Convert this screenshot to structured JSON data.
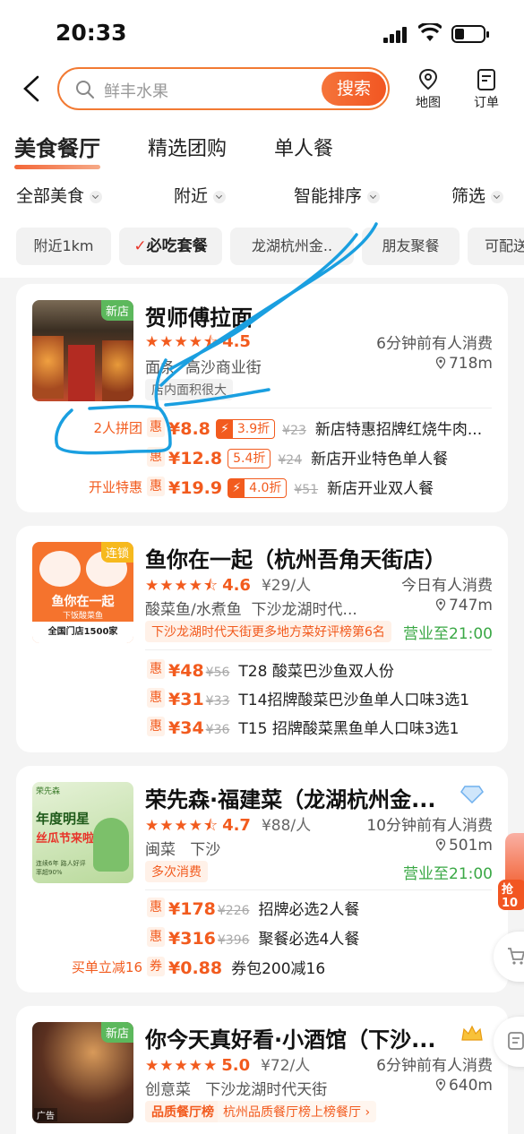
{
  "status": {
    "time": "20:33"
  },
  "header": {
    "search_placeholder": "鲜丰水果",
    "search_button": "搜索",
    "map_label": "地图",
    "orders_label": "订单"
  },
  "tabs": [
    "美食餐厅",
    "精选团购",
    "单人餐"
  ],
  "filters": [
    "全部美食",
    "附近",
    "智能排序",
    "筛选"
  ],
  "chips": [
    "附近1km",
    "必吃套餐",
    "龙湖杭州金..",
    "朋友聚餐",
    "可配送"
  ],
  "restaurants": [
    {
      "name": "贺师傅拉面",
      "badge": "新店",
      "stars": "★★★★⯪",
      "score": "4.5",
      "avg": "",
      "recent": "6分钟前有人消费",
      "category": "面条",
      "area": "高沙商业街",
      "distance": "718m",
      "tag": "店内面积很大",
      "deals": [
        {
          "label": "2人拼团",
          "price": "¥8.8",
          "discount": "3.9折",
          "orig": "¥23",
          "name": "新店特惠招牌红烧牛肉..."
        },
        {
          "label": "",
          "price": "¥12.8",
          "discount": "5.4折",
          "orig": "¥24",
          "name": "新店开业特色单人餐"
        },
        {
          "label": "开业特惠",
          "price": "¥19.9",
          "discount": "4.0折",
          "orig": "¥51",
          "name": "新店开业双人餐"
        }
      ]
    },
    {
      "name": "鱼你在一起（杭州吾角天街店）",
      "badge": "连锁",
      "logo_main": "鱼你在一起",
      "logo_sub": "下饭酸菜鱼",
      "logo_foot": "全国门店1500家",
      "stars": "★★★★⯪",
      "score": "4.6",
      "avg": "¥29/人",
      "recent": "今日有人消费",
      "category": "酸菜鱼/水煮鱼",
      "area": "下沙龙湖时代...",
      "distance": "747m",
      "tag": "下沙龙湖时代天街更多地方菜好评榜第6名",
      "open": "营业至21:00",
      "deals": [
        {
          "price": "¥48",
          "orig": "¥56",
          "name": "T28 酸菜巴沙鱼双人份"
        },
        {
          "price": "¥31",
          "orig": "¥33",
          "name": "T14招牌酸菜巴沙鱼单人口味3选1"
        },
        {
          "price": "¥34",
          "orig": "¥36",
          "name": "T15 招牌酸菜黑鱼单人口味3选1"
        }
      ]
    },
    {
      "name": "荣先森·福建菜（龙湖杭州金...",
      "logo_top": "荣先森",
      "logo_main": "年度明星",
      "logo_sub": "丝瓜节来啦",
      "logo_foot": "连续6年 路人好评率超90%",
      "stars": "★★★★⯪",
      "score": "4.7",
      "avg": "¥88/人",
      "recent": "10分钟前有人消费",
      "category": "闽菜",
      "area": "下沙",
      "distance": "501m",
      "tag": "多次消费",
      "open": "营业至21:00",
      "deals": [
        {
          "label": "",
          "type": "惠",
          "price": "¥178",
          "orig": "¥226",
          "name": "招牌必选2人餐"
        },
        {
          "label": "",
          "type": "惠",
          "price": "¥316",
          "orig": "¥396",
          "name": "聚餐必选4人餐"
        },
        {
          "label": "买单立减16",
          "type": "券",
          "price": "¥0.88",
          "orig": "",
          "name": "券包200减16"
        }
      ]
    },
    {
      "name": "你今天真好看·小酒馆（下沙...",
      "badge": "新店",
      "ad": "广告",
      "stars": "★★★★★",
      "score": "5.0",
      "avg": "¥72/人",
      "recent": "6分钟前有人消费",
      "category": "创意菜",
      "area": "下沙龙湖时代天街",
      "distance": "640m",
      "rank_label": "品质餐厅榜",
      "rank_text": "杭州品质餐厅榜上榜餐厅 ›"
    }
  ],
  "deal_type": "惠",
  "side_red_label": "抢10",
  "colors": {
    "accent": "#f25b1e",
    "green": "#3aa845",
    "annotation": "#1a9fe0"
  }
}
